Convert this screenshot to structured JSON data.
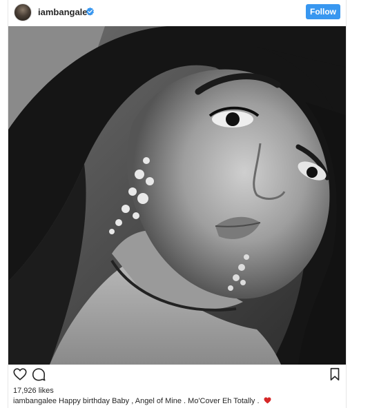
{
  "header": {
    "username": "iambangalee",
    "verified": true,
    "follow_label": "Follow",
    "follow_color": "#3897f0"
  },
  "post": {
    "photo_icon": "selfie-photo",
    "likes_text": "17,926 likes",
    "caption_user": "iambangalee",
    "caption_text": " Happy birthday Baby , Angel of Mine . Mo'Cover Eh Totally . ",
    "caption_emoji": "red-heart-icon"
  },
  "actions": {
    "like_icon": "heart-icon",
    "comment_icon": "comment-icon",
    "save_icon": "bookmark-icon"
  }
}
